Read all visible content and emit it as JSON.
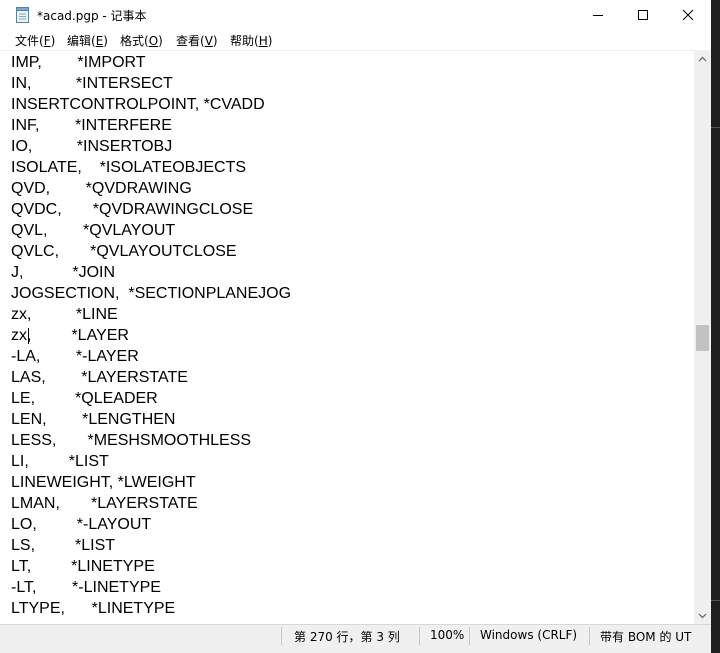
{
  "window": {
    "title": "*acad.pgp - 记事本",
    "icons": {
      "app": "notepad-icon",
      "minimize": "minimize-icon",
      "maximize": "maximize-icon",
      "close": "close-icon"
    }
  },
  "menu": [
    {
      "label": "文件(",
      "key": "F",
      "suffix": ")"
    },
    {
      "label": "编辑(",
      "key": "E",
      "suffix": ")"
    },
    {
      "label": "格式(",
      "key": "O",
      "suffix": ")"
    },
    {
      "label": "查看(",
      "key": "V",
      "suffix": ")"
    },
    {
      "label": "帮助(",
      "key": "H",
      "suffix": ")"
    }
  ],
  "editor": {
    "lines": [
      "IMP,        *IMPORT",
      "IN,          *INTERSECT",
      "INSERTCONTROLPOINT, *CVADD",
      "INF,        *INTERFERE",
      "IO,          *INSERTOBJ",
      "ISOLATE,    *ISOLATEOBJECTS",
      "QVD,        *QVDRAWING",
      "QVDC,       *QVDRAWINGCLOSE",
      "QVL,        *QVLAYOUT",
      "QVLC,       *QVLAYOUTCLOSE",
      "J,           *JOIN",
      "JOGSECTION,  *SECTIONPLANEJOG",
      "zx,          *LINE",
      "zx,         *LAYER",
      "-LA,        *-LAYER",
      "LAS,        *LAYERSTATE",
      "LE,         *QLEADER",
      "LEN,        *LENGTHEN",
      "LESS,       *MESHSMOOTHLESS",
      "LI,         *LIST",
      "LINEWEIGHT, *LWEIGHT",
      "LMAN,       *LAYERSTATE",
      "LO,         *-LAYOUT",
      "LS,         *LIST",
      "LT,         *LINETYPE",
      "-LT,        *-LINETYPE",
      "LTYPE,      *LINETYPE"
    ]
  },
  "statusbar": {
    "position": "第 270 行，第 3 列",
    "zoom": "100%",
    "line_ending": "Windows (CRLF)",
    "encoding": "带有 BOM 的 UT"
  }
}
